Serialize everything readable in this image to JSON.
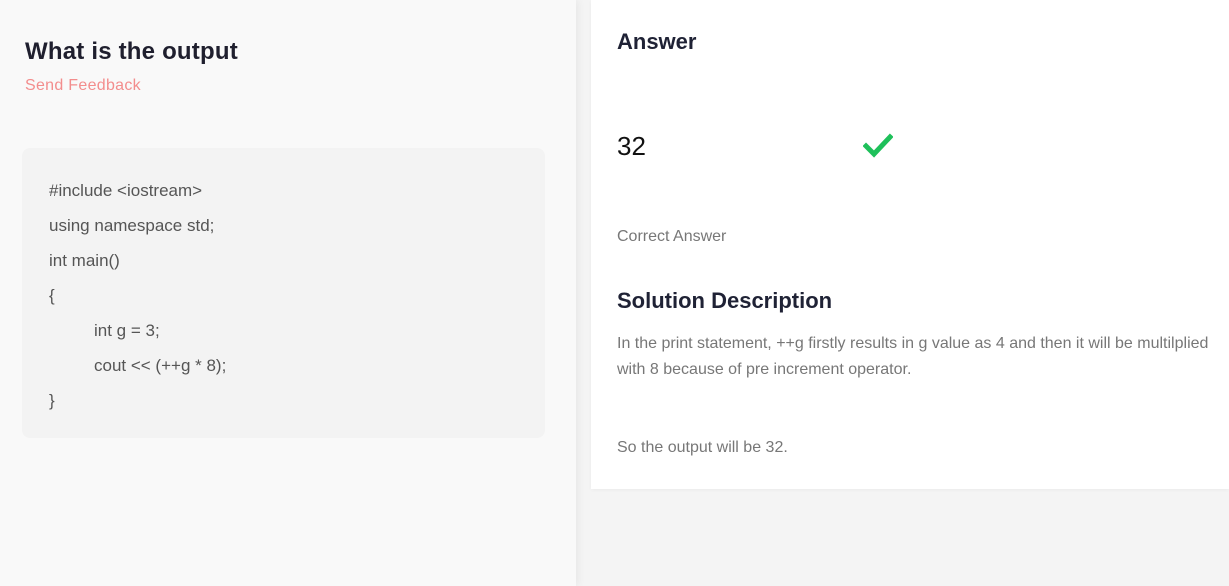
{
  "question": {
    "title": "What is the output",
    "feedback_label": "Send Feedback",
    "code_lines": [
      "#include <iostream>",
      "using namespace std;",
      "int main()",
      "{",
      "int g = 3;",
      "cout << (++g * 8);",
      "}"
    ]
  },
  "answer": {
    "heading": "Answer",
    "value": "32",
    "status_icon": "check-icon",
    "status_color": "#1ec05a",
    "status_label": "Correct Answer"
  },
  "solution": {
    "heading": "Solution Description",
    "text": "In the print statement, ++g firstly results in g value as 4 and then it will be multilplied with 8 because of pre increment operator.",
    "conclusion": "So the output will be 32."
  },
  "colors": {
    "feedback": "#f38d8d",
    "heading": "#1f2235",
    "muted_text": "#777777"
  }
}
